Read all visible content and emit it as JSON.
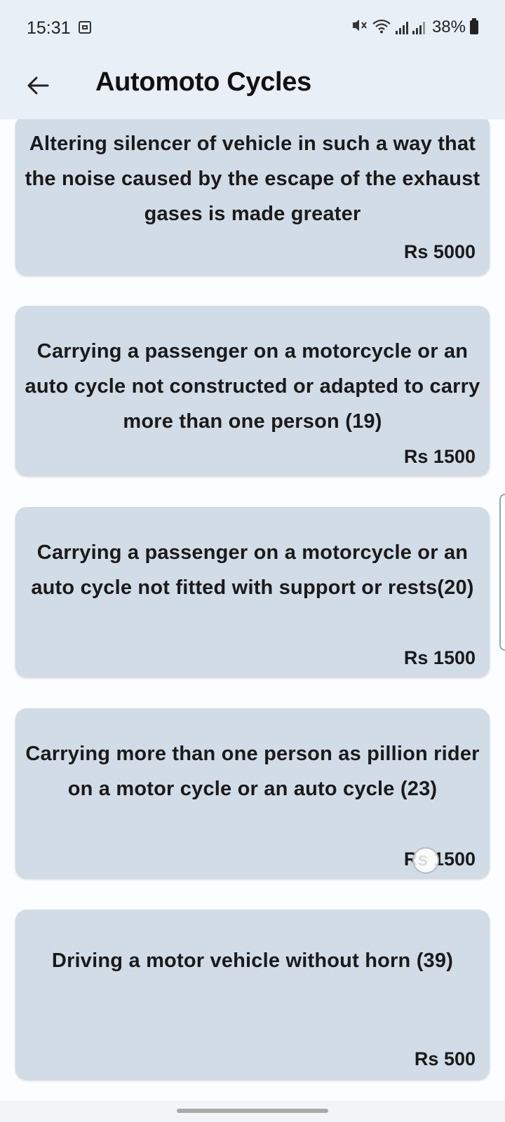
{
  "status_bar": {
    "time": "15:31",
    "battery": "38%"
  },
  "app_bar": {
    "title": "Automoto Cycles"
  },
  "offenses": [
    {
      "description": "Altering silencer of vehicle in such a way that the noise caused by the escape of the exhaust gases is made greater",
      "fine": "Rs 5000"
    },
    {
      "description": "Carrying a passenger on a motorcycle or an auto cycle not constructed or adapted to carry more than one person (19)",
      "fine": "Rs 1500"
    },
    {
      "description": "Carrying a passenger on a motorcycle or an auto cycle not fitted with support or rests(20)",
      "fine": "Rs 1500"
    },
    {
      "description": "Carrying more than one person as pillion rider on a motor cycle or an auto cycle (23)",
      "fine": "Rs 1500"
    },
    {
      "description": "Driving a motor vehicle without horn (39)",
      "fine": "Rs 500"
    }
  ],
  "colors": {
    "app_bar_bg": "#e9eff6",
    "card_bg": "#d2dce6",
    "text": "#1a1a1a"
  }
}
